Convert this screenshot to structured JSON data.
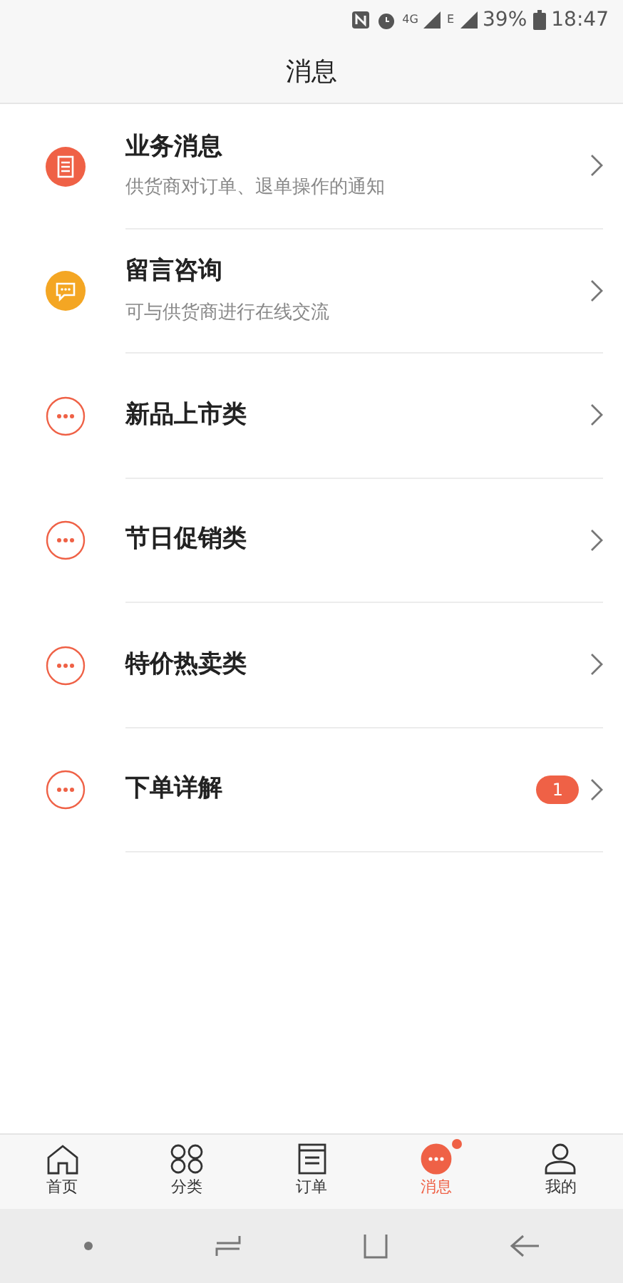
{
  "status_bar": {
    "network": "4G",
    "network_2": "E",
    "battery": "39%",
    "time": "18:47"
  },
  "header": {
    "title": "消息"
  },
  "messages": [
    {
      "kind": "document",
      "title": "业务消息",
      "subtitle": "供货商对订单、退单操作的通知",
      "color": "#ef6146"
    },
    {
      "kind": "chat",
      "title": "留言咨询",
      "subtitle": "可与供货商进行在线交流",
      "color": "#f4a623"
    },
    {
      "kind": "more",
      "title": "新品上市类"
    },
    {
      "kind": "more",
      "title": "节日促销类"
    },
    {
      "kind": "more",
      "title": "特价热卖类"
    },
    {
      "kind": "more",
      "title": "下单详解",
      "badge": "1"
    }
  ],
  "tabs": [
    {
      "kind": "home",
      "label": "首页",
      "selected": false,
      "dot": false
    },
    {
      "kind": "category",
      "label": "分类",
      "selected": false,
      "dot": false
    },
    {
      "kind": "order",
      "label": "订单",
      "selected": false,
      "dot": false
    },
    {
      "kind": "message",
      "label": "消息",
      "selected": true,
      "dot": true
    },
    {
      "kind": "profile",
      "label": "我的",
      "selected": false,
      "dot": false
    }
  ]
}
